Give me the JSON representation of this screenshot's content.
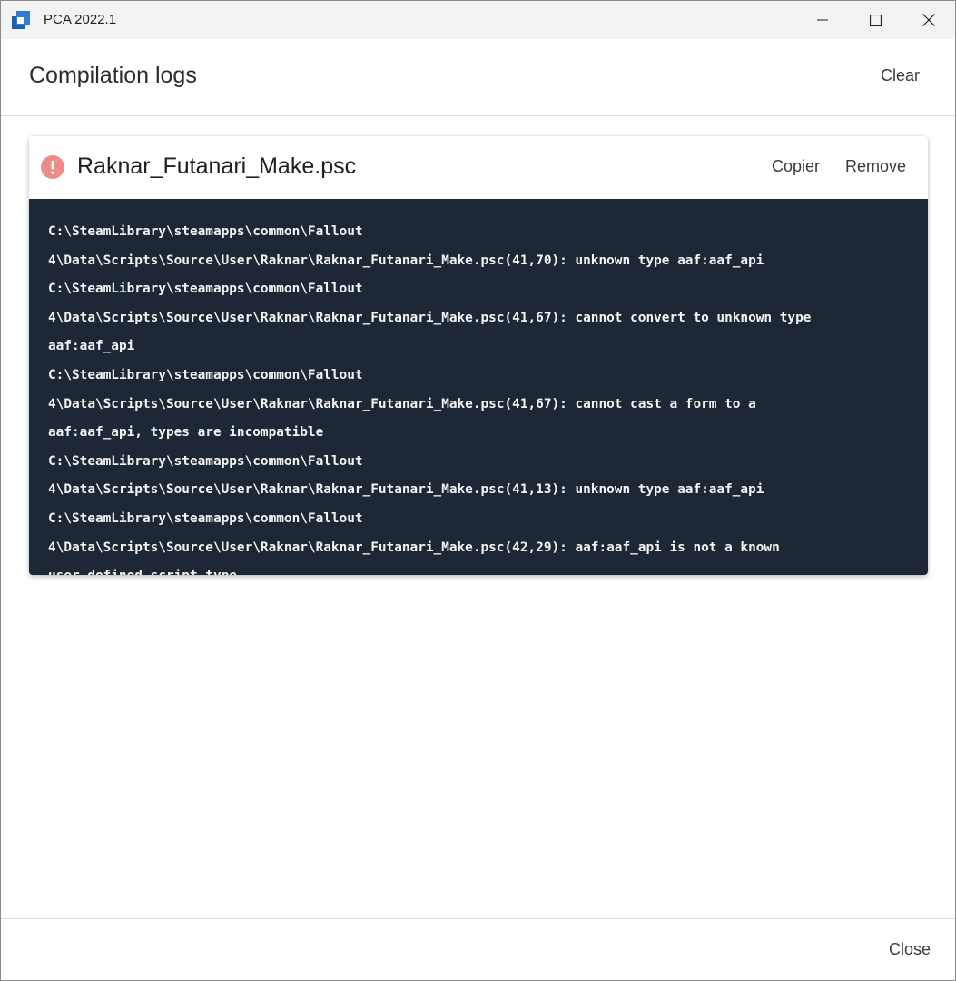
{
  "window": {
    "title": "PCA 2022.1",
    "controls": {
      "minimize": "minimize",
      "maximize": "maximize",
      "close": "close"
    }
  },
  "header": {
    "title": "Compilation logs",
    "clear_label": "Clear"
  },
  "log_card": {
    "file_name": "Raknar_Futanari_Make.psc",
    "status_icon": "error-icon",
    "status_color": "#ef8b8b",
    "copy_label": "Copier",
    "remove_label": "Remove",
    "lines": [
      "C:\\SteamLibrary\\steamapps\\common\\Fallout",
      "4\\Data\\Scripts\\Source\\User\\Raknar\\Raknar_Futanari_Make.psc(41,70): unknown type aaf:aaf_api",
      "C:\\SteamLibrary\\steamapps\\common\\Fallout",
      "4\\Data\\Scripts\\Source\\User\\Raknar\\Raknar_Futanari_Make.psc(41,67): cannot convert to unknown type",
      "aaf:aaf_api",
      "C:\\SteamLibrary\\steamapps\\common\\Fallout",
      "4\\Data\\Scripts\\Source\\User\\Raknar\\Raknar_Futanari_Make.psc(41,67): cannot cast a form to a",
      "aaf:aaf_api, types are incompatible",
      "C:\\SteamLibrary\\steamapps\\common\\Fallout",
      "4\\Data\\Scripts\\Source\\User\\Raknar\\Raknar_Futanari_Make.psc(41,13): unknown type aaf:aaf_api",
      "C:\\SteamLibrary\\steamapps\\common\\Fallout",
      "4\\Data\\Scripts\\Source\\User\\Raknar\\Raknar_Futanari_Make.psc(42,29): aaf:aaf_api is not a known",
      "user-defined script type"
    ]
  },
  "footer": {
    "close_label": "Close"
  },
  "colors": {
    "log_background": "#1e2736",
    "log_text": "#f4f5f7",
    "titlebar": "#f3f3f3",
    "app_icon_blue": "#1c5fb0"
  }
}
